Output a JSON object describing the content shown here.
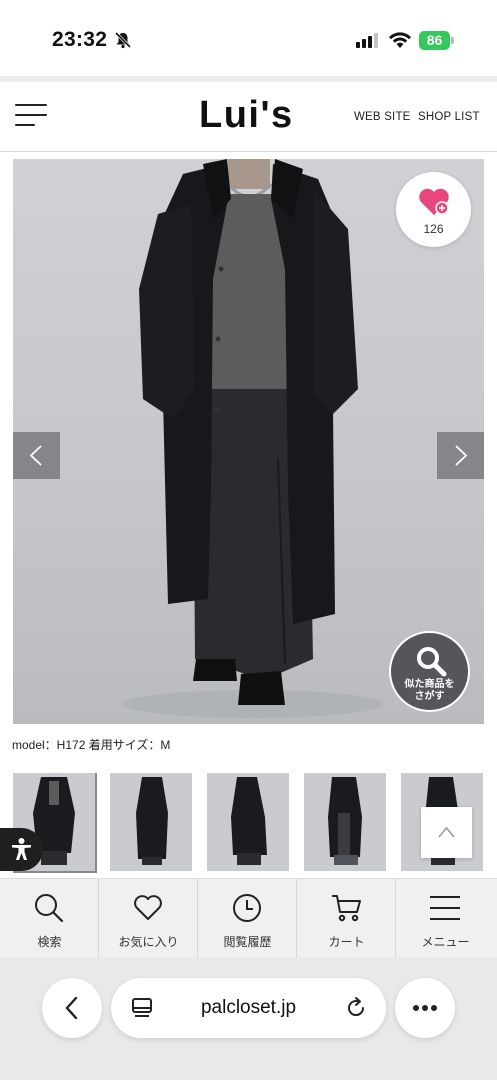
{
  "status_bar": {
    "time": "23:32",
    "battery": "86",
    "icons": [
      "bell-slash-icon",
      "signal-icon",
      "wifi-icon",
      "battery-icon"
    ]
  },
  "header": {
    "logo": "Lui's",
    "nav": [
      "WEB SITE",
      "SHOP LIST"
    ]
  },
  "product_gallery": {
    "like_count": "126",
    "similar_button": [
      "似た商品を",
      "さがす"
    ],
    "model_info": "model：H172 着用サイズ：M"
  },
  "bottom_nav": [
    {
      "label": "検索",
      "icon": "search-icon"
    },
    {
      "label": "お気に入り",
      "icon": "heart-icon"
    },
    {
      "label": "閲覧履歴",
      "icon": "clock-icon"
    },
    {
      "label": "カート",
      "icon": "cart-icon"
    },
    {
      "label": "メニュー",
      "icon": "menu-icon"
    }
  ],
  "browser": {
    "url": "palcloset.jp"
  },
  "colors": {
    "accent_pink": "#e8467c",
    "battery_green": "#34c759"
  }
}
